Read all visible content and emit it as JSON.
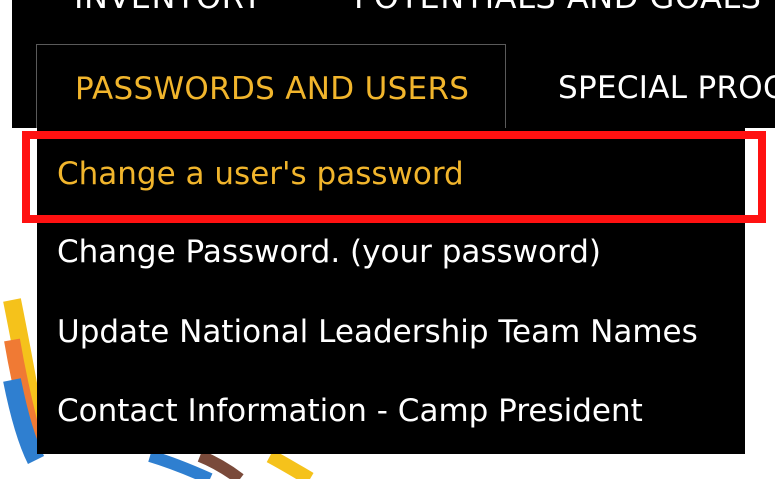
{
  "nav": {
    "top_items": [
      "INVENTORY",
      "POTENTIALS AND GOALS"
    ],
    "tabs": [
      {
        "label": "PASSWORDS AND USERS",
        "active": true
      },
      {
        "label": "SPECIAL PROGRAMS",
        "active": false
      }
    ]
  },
  "dropdown": {
    "items": [
      {
        "label": "Change a user's password",
        "highlighted": true
      },
      {
        "label": "Change Password. (your password)",
        "highlighted": false
      },
      {
        "label": "Update National Leadership Team Names",
        "highlighted": false
      },
      {
        "label": "Contact Information - Camp President",
        "highlighted": false
      }
    ]
  },
  "colors": {
    "nav_background": "#000000",
    "accent_gold": "#f1b52c",
    "menu_text": "#ffffff",
    "callout_red": "#ff1111",
    "swoosh_orange": "#f07a34",
    "swoosh_blue": "#2f7fd0",
    "swoosh_yellow": "#f5c21b",
    "swoosh_brown": "#7a4a3a"
  }
}
